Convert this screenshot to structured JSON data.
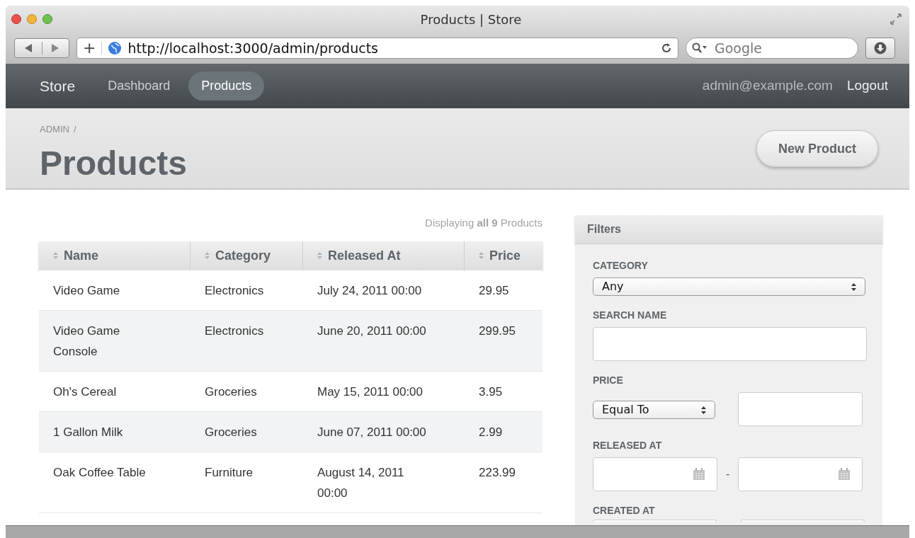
{
  "window": {
    "title": "Products | Store"
  },
  "toolbar": {
    "new_tab": "+",
    "url": "http://localhost:3000/admin/products",
    "search_placeholder": "Google"
  },
  "nav": {
    "brand": "Store",
    "items": [
      {
        "label": "Dashboard",
        "selected": false
      },
      {
        "label": "Products",
        "selected": true
      }
    ],
    "user": "admin@example.com",
    "logout": "Logout"
  },
  "header": {
    "breadcrumb": "ADMIN",
    "separator": "/",
    "title": "Products",
    "action": "New Product"
  },
  "table": {
    "summary": "Displaying **all 9** Products",
    "columns": [
      "Name",
      "Category",
      "Released At",
      "Price"
    ],
    "rows": [
      [
        "Video Game",
        "Electronics",
        "July 24, 2011 00:00",
        "29.95"
      ],
      [
        "Video Game Console",
        "Electronics",
        "June 20, 2011 00:00",
        "299.95"
      ],
      [
        "Oh's Cereal",
        "Groceries",
        "May 15, 2011 00:00",
        "3.95"
      ],
      [
        "1 Gallon Milk",
        "Groceries",
        "June 07, 2011 00:00",
        "2.99"
      ],
      [
        "Oak Coffee Table",
        "Furniture",
        "August 14, 2011 00:00",
        "223.99"
      ]
    ]
  },
  "filters": {
    "title": "Filters",
    "fields": [
      {
        "kind": "select",
        "label": "CATEGORY",
        "value": "Any"
      },
      {
        "kind": "text",
        "label": "SEARCH NAME"
      },
      {
        "kind": "numeric",
        "label": "PRICE",
        "value": "Equal To"
      },
      {
        "kind": "date_range",
        "label": "RELEASED AT",
        "separator": "-"
      },
      {
        "kind": "date_range",
        "label": "CREATED AT",
        "clipped": true
      }
    ]
  }
}
